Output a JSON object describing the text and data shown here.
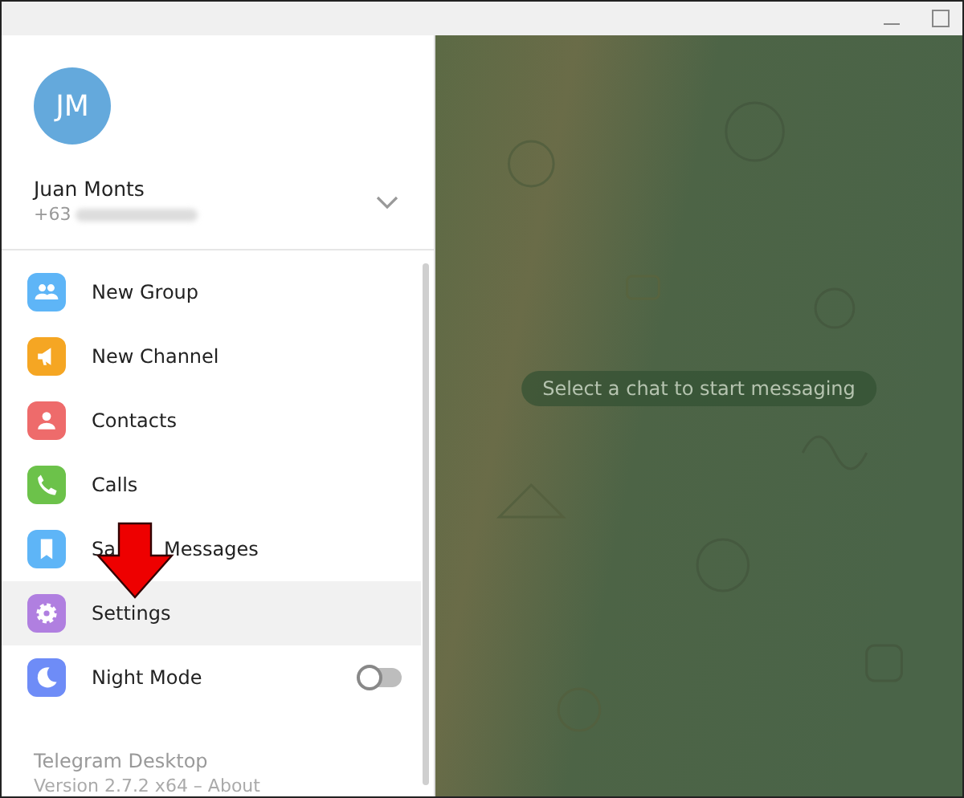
{
  "profile": {
    "initials": "JM",
    "name": "Juan Monts",
    "phone_prefix": "+63"
  },
  "menu": [
    {
      "kind": "plain",
      "label": "New Group",
      "selected": false
    },
    {
      "kind": "plain",
      "label": "New Channel",
      "selected": false
    },
    {
      "kind": "plain",
      "label": "Contacts",
      "selected": false
    },
    {
      "kind": "plain",
      "label": "Calls",
      "selected": false
    },
    {
      "kind": "covered",
      "label_start": "Sa",
      "label_end": "Messages",
      "selected": false
    },
    {
      "kind": "plain",
      "label": "Settings",
      "selected": true
    },
    {
      "kind": "toggle",
      "label": "Night Mode",
      "selected": false,
      "on": false
    }
  ],
  "footer": {
    "app": "Telegram Desktop",
    "version": "Version 2.7.2 x64 – About"
  },
  "chat": {
    "empty_hint": "Select a chat to start messaging"
  }
}
